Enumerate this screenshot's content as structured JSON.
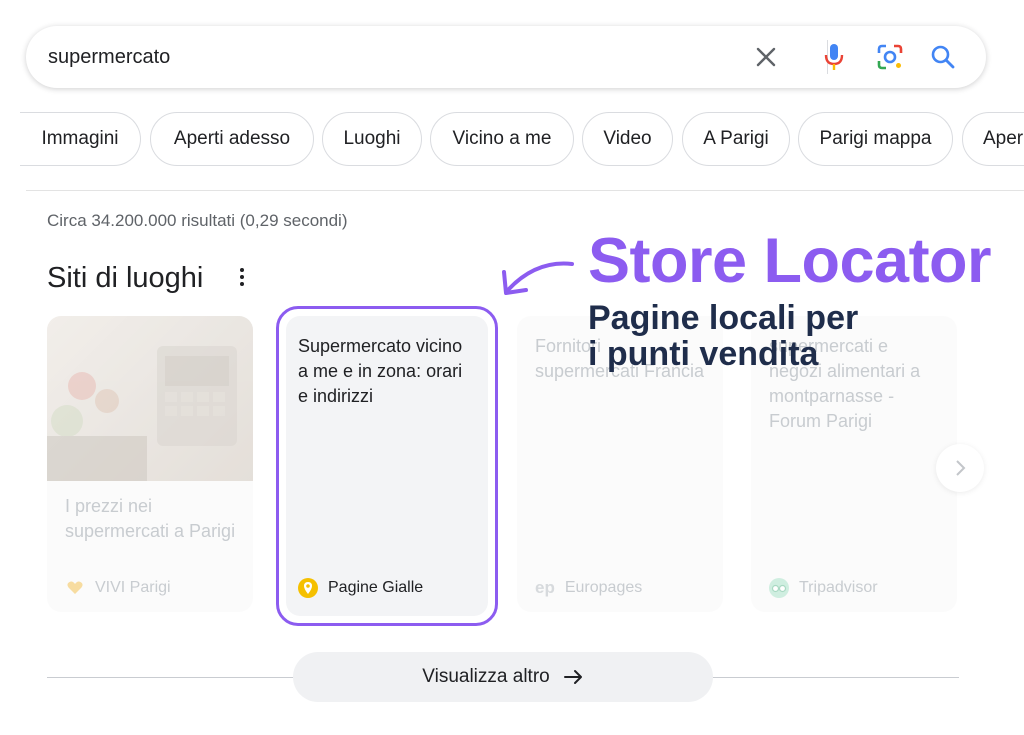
{
  "search": {
    "query": "supermercato",
    "icons": [
      "close-icon",
      "mic-icon",
      "lens-icon",
      "search-icon"
    ]
  },
  "chips": [
    "Immagini",
    "Aperti adesso",
    "Luoghi",
    "Vicino a me",
    "Video",
    "A Parigi",
    "Parigi mappa",
    "Aper"
  ],
  "stats": "Circa 34.200.000 risultati (0,29 secondi)",
  "section": {
    "title": "Siti di luoghi"
  },
  "cards": [
    {
      "text": "I prezzi nei supermercati a Parigi",
      "source": "VIVI Parigi",
      "icon": "heart-icon"
    },
    {
      "text": "Supermercato vicino a me e in zona: orari e indirizzi",
      "source": "Pagine Gialle",
      "icon": "pagine-gialle-icon"
    },
    {
      "text": "Fornitori supermercati Francia",
      "source": "Europages",
      "icon": "europages-icon"
    },
    {
      "text": "supermercati e negozi alimentari a montparnasse - Forum Parigi",
      "source": "Tripadvisor",
      "icon": "tripadvisor-icon"
    }
  ],
  "overlay": {
    "title": "Store Locator",
    "subtitle_line1": "Pagine locali per",
    "subtitle_line2": "i punti vendita"
  },
  "more_button": "Visualizza altro",
  "colors": {
    "accent": "#8c5cf0",
    "navy": "#1f2d4b"
  }
}
